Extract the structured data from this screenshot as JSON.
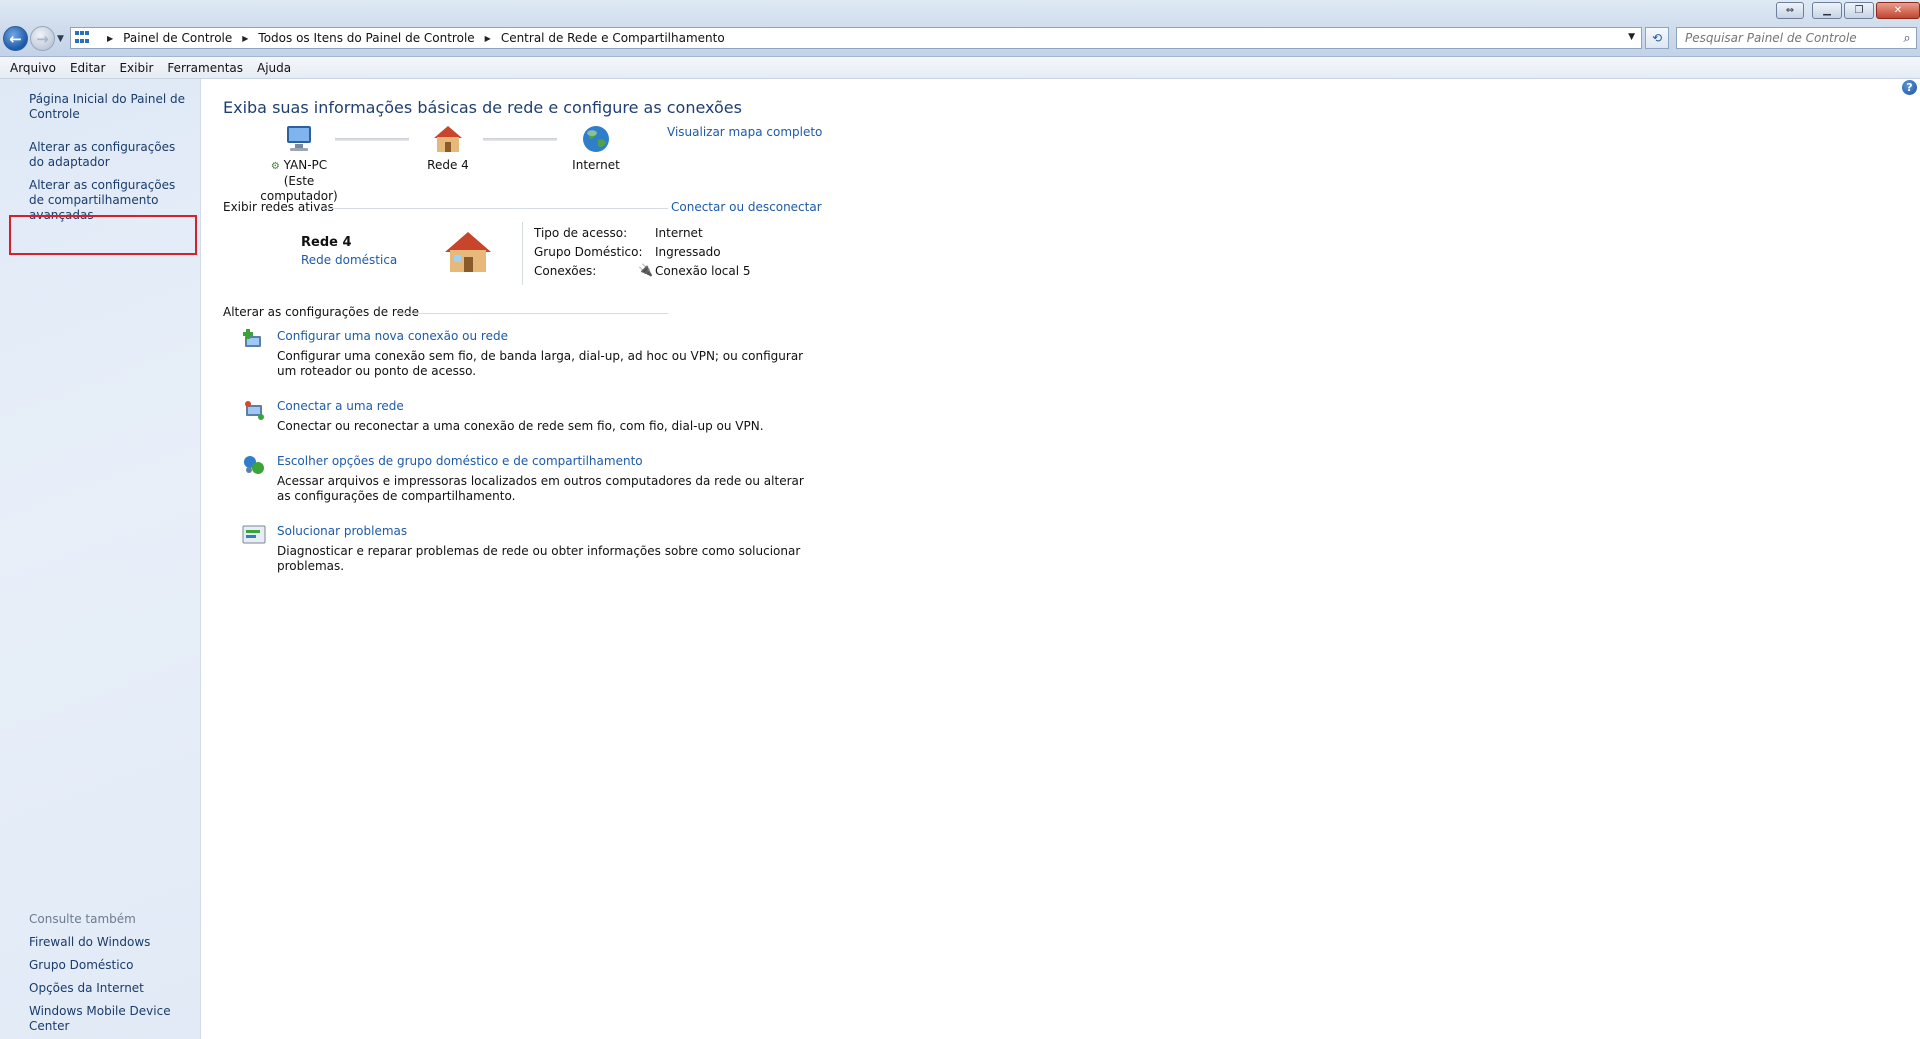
{
  "address": {
    "breadcrumbs": [
      "Painel de Controle",
      "Todos os Itens do Painel de Controle",
      "Central de Rede e Compartilhamento"
    ],
    "search_placeholder": "Pesquisar Painel de Controle"
  },
  "menu": [
    "Arquivo",
    "Editar",
    "Exibir",
    "Ferramentas",
    "Ajuda"
  ],
  "left_pane": {
    "links": [
      "Página Inicial do Painel de Controle",
      "Alterar as configurações do adaptador",
      "Alterar as configurações de compartilhamento avançadas"
    ],
    "see_also_title": "Consulte também",
    "see_also": [
      "Firewall do Windows",
      "Grupo Doméstico",
      "Opções da Internet",
      "Windows Mobile Device Center"
    ]
  },
  "main": {
    "title": "Exiba suas informações básicas de rede e configure as conexões",
    "map_link": "Visualizar mapa completo",
    "map": {
      "computer_name": "YAN-PC",
      "computer_sub": "(Este computador)",
      "network": "Rede  4",
      "internet": "Internet"
    },
    "active_networks": {
      "heading": "Exibir redes ativas",
      "connect_link": "Conectar ou desconectar",
      "network_name": "Rede  4",
      "network_type": "Rede doméstica",
      "access_label": "Tipo de acesso:",
      "access_value": "Internet",
      "homegroup_label": "Grupo Doméstico:",
      "homegroup_value": "Ingressado",
      "connections_label": "Conexões:",
      "connections_value": "Conexão local 5"
    },
    "change_settings": {
      "heading": "Alterar as configurações de rede",
      "tasks": [
        {
          "title": "Configurar uma nova conexão ou rede",
          "desc": "Configurar uma conexão sem fio, de banda larga, dial-up, ad hoc ou VPN; ou configurar um roteador ou ponto de acesso."
        },
        {
          "title": "Conectar a uma rede",
          "desc": "Conectar ou reconectar a uma conexão de rede sem fio, com fio, dial-up ou VPN."
        },
        {
          "title": "Escolher opções de grupo doméstico e de compartilhamento",
          "desc": "Acessar arquivos e impressoras localizados em outros computadores da rede ou alterar as configurações de compartilhamento."
        },
        {
          "title": "Solucionar problemas",
          "desc": "Diagnosticar e reparar problemas de rede ou obter informações sobre como solucionar problemas."
        }
      ]
    }
  },
  "colors": {
    "link": "#1e5aa8",
    "title": "#1f3f72",
    "highlight_box": "#d2222d"
  }
}
